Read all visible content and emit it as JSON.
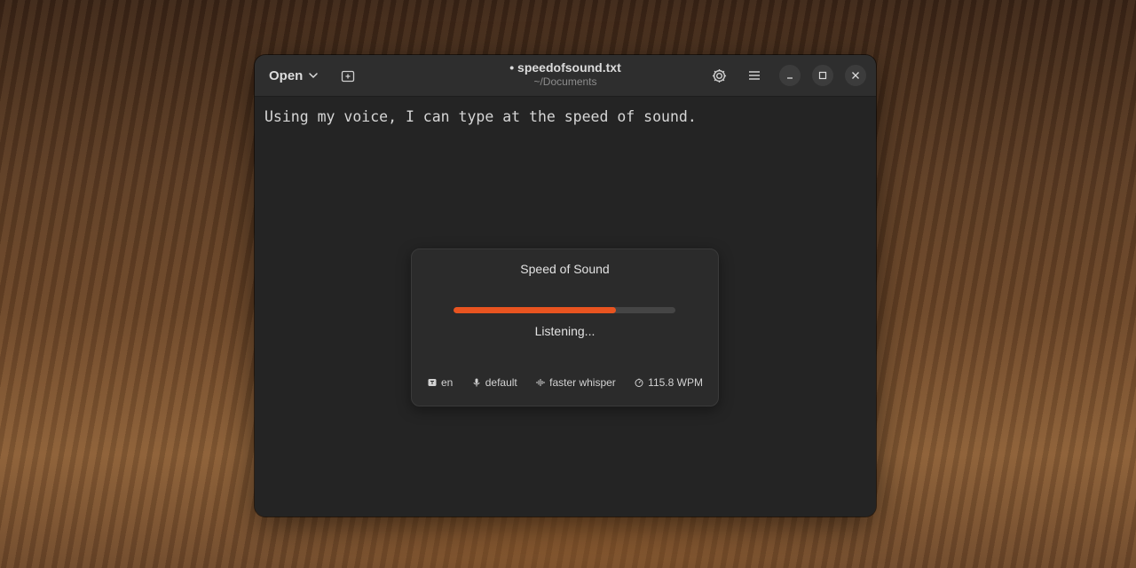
{
  "window": {
    "title": "• speedofsound.txt",
    "subtitle": "~/Documents"
  },
  "header": {
    "open_label": "Open",
    "icons": [
      "chevron-down-icon",
      "new-tab-icon",
      "gear-icon",
      "menu-icon",
      "minimize-icon",
      "maximize-icon",
      "close-icon"
    ]
  },
  "editor": {
    "content": "Using my voice, I can type at the speed of sound."
  },
  "dialog": {
    "title": "Speed of Sound",
    "progress": 0.73,
    "status": "Listening...",
    "info": {
      "language": "en",
      "microphone": "default",
      "model": "faster whisper",
      "speed": "115.8 WPM"
    }
  },
  "colors": {
    "accent": "#e95420",
    "window_bg": "#242424",
    "header_bg": "#2e2e2e",
    "dialog_bg": "#2b2b2b"
  }
}
